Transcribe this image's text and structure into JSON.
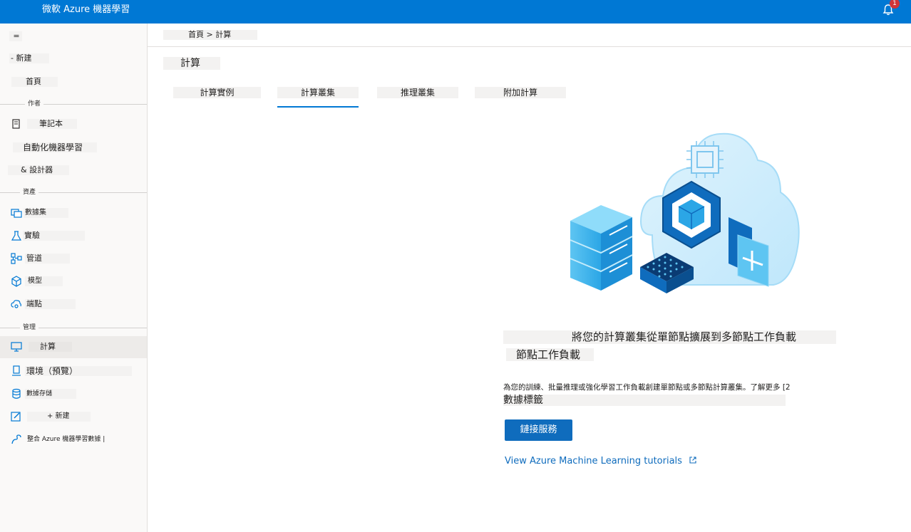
{
  "header": {
    "title": "微軟 Azure 機器學習",
    "notification_count": "1"
  },
  "sidebar": {
    "menu_toggle": "=",
    "new_label": "- 新建",
    "home_label": "首頁",
    "sections": {
      "author": "作者",
      "assets": "資產",
      "manage": "管理"
    },
    "author_items": [
      {
        "label": "筆記本",
        "icon": "notebook-icon"
      },
      {
        "label": "自動化機器學習",
        "icon": "automl-icon"
      },
      {
        "label": "& 設計器",
        "icon": "designer-icon"
      }
    ],
    "asset_items": [
      {
        "label": "數據集",
        "icon": "datasets-icon"
      },
      {
        "label": "實驗",
        "icon": "flask-icon"
      },
      {
        "label": "管道",
        "icon": "pipeline-icon"
      },
      {
        "label": "模型",
        "icon": "cube-icon"
      },
      {
        "label": "端點",
        "icon": "endpoint-icon"
      }
    ],
    "manage_items": [
      {
        "label": "計算",
        "icon": "monitor-icon"
      },
      {
        "label": "環境（預覽）",
        "icon": "environment-icon"
      },
      {
        "label": "數據存儲",
        "icon": "database-icon"
      },
      {
        "label": "+ 新建",
        "icon": "edit-icon"
      },
      {
        "label": "整合 Azure 機器學習數據 |",
        "icon": "link-icon"
      }
    ]
  },
  "breadcrumb": "首頁 > 計算",
  "page_title": "計算",
  "tabs": [
    {
      "label": "計算實例"
    },
    {
      "label": "計算叢集"
    },
    {
      "label": "推理叢集"
    },
    {
      "label": "附加計算"
    }
  ],
  "active_tab": "計算叢集",
  "empty_state": {
    "headline": "將您的計算叢集從單節點擴展到多節點工作負載",
    "headline_tail": "節點工作負載",
    "description": "為您的訓練、批量推理或強化學習工作負載創建單節點或多節點計算叢集。了解更多 [2",
    "description_tail": "數據標籤",
    "primary_button": "鏈接服務",
    "tutorial_link": "View Azure Machine Learning tutorials"
  },
  "colors": {
    "brand": "#0078d4",
    "button": "#0f6cbd",
    "sidebar_bg": "#faf9f8"
  }
}
